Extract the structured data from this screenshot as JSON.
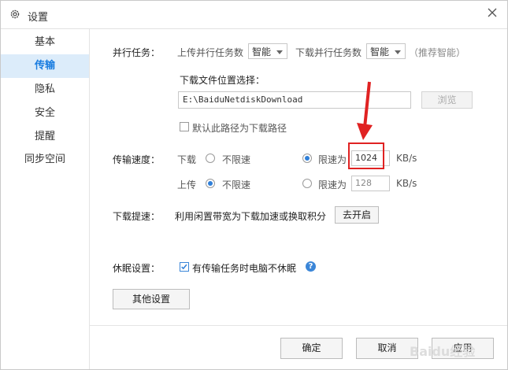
{
  "window": {
    "title": "设置",
    "icons": {
      "title": "gear-icon",
      "close": "close-icon"
    }
  },
  "sidebar": {
    "items": [
      {
        "label": "基本"
      },
      {
        "label": "传输"
      },
      {
        "label": "隐私"
      },
      {
        "label": "安全"
      },
      {
        "label": "提醒"
      },
      {
        "label": "同步空间"
      }
    ],
    "active_index": 1
  },
  "parallel": {
    "section_label": "并行任务：",
    "upload_label": "上传并行任务数",
    "upload_value": "智能",
    "download_label": "下载并行任务数",
    "download_value": "智能",
    "hint": "（推荐智能）"
  },
  "download_location": {
    "heading": "下载文件位置选择：",
    "path": "E:\\BaiduNetdiskDownload",
    "browse_label": "浏览",
    "default_checkbox_label": "默认此路径为下载路径",
    "default_checked": false
  },
  "speed": {
    "section_label": "传输速度：",
    "download_label": "下载",
    "upload_label": "上传",
    "unlimited_label": "不限速",
    "limit_label": "限速为",
    "download_limit_value": "1024",
    "upload_limit_value": "128",
    "unit": "KB/s",
    "download_mode": "limit",
    "upload_mode": "unlimited"
  },
  "boost": {
    "section_label": "下载提速：",
    "description": "利用闲置带宽为下载加速或换取积分",
    "button_label": "去开启"
  },
  "sleep": {
    "section_label": "休眠设置：",
    "checkbox_label": "有传输任务时电脑不休眠",
    "checked": true,
    "help_glyph": "?"
  },
  "other_settings_label": "其他设置",
  "footer": {
    "ok_label": "确定",
    "cancel_label": "取消",
    "apply_label": "应用"
  },
  "watermark": "Baidu经验",
  "accent_color": "#1a7de0",
  "annotation_color": "#e02222"
}
